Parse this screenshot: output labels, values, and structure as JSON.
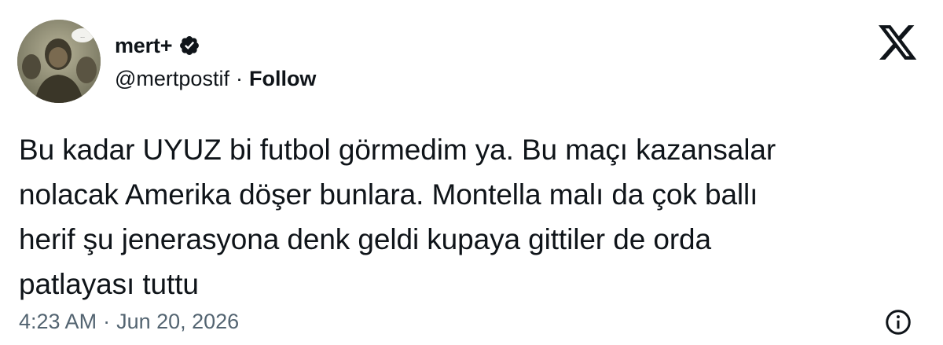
{
  "author": {
    "display_name": "mert+",
    "handle": "@mertpostif",
    "follow_label": "Follow",
    "separator": "·",
    "verified": true,
    "verified_icon": "verified-badge-icon"
  },
  "brand": {
    "logo": "x-logo-icon"
  },
  "tweet": {
    "lines": [
      "Bu kadar UYUZ bi futbol görmedim ya. Bu maçı kazansalar",
      "nolacak Amerika döşer bunlara. Montella malı da çok ballı",
      "herif şu jenerasyona denk geldi kupaya gittiler de orda",
      "patlayası tuttu"
    ]
  },
  "meta": {
    "time": "4:23 AM",
    "separator": "·",
    "date": "Jun 20, 2026",
    "info_icon": "info-icon"
  },
  "colors": {
    "text": "#0f1419",
    "secondary": "#536471",
    "background": "#ffffff"
  }
}
